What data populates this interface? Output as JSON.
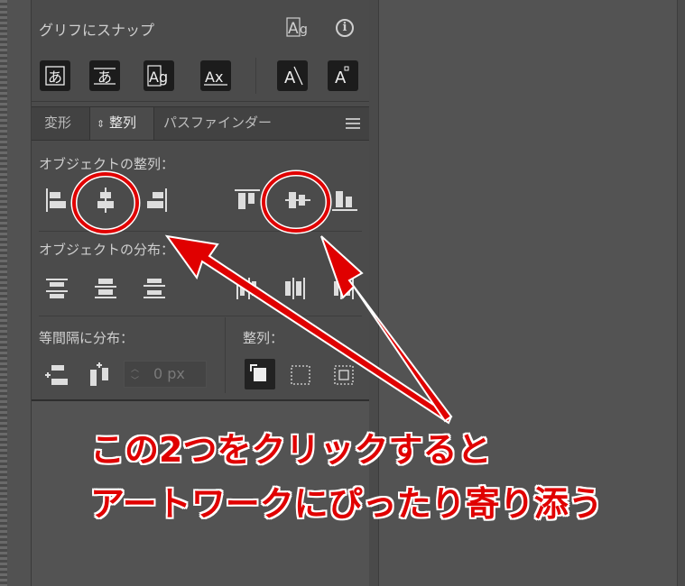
{
  "snap": {
    "title": "グリフにスナップ",
    "buttons": [
      {
        "label": "あ",
        "icon": "glyph-hiragana-icon"
      },
      {
        "label": "あ",
        "icon": "glyph-hiragana-bounds-icon"
      },
      {
        "label": "Ag",
        "icon": "glyph-ag-bounds-icon"
      },
      {
        "label": "Ax",
        "icon": "glyph-ax-baseline-icon"
      },
      {
        "label": "A",
        "icon": "glyph-angle-icon"
      },
      {
        "label": "A",
        "icon": "glyph-anchor-icon"
      }
    ]
  },
  "tabs": [
    {
      "label": "変形"
    },
    {
      "label": "整列"
    },
    {
      "label": "パスファインダー"
    }
  ],
  "align_objects": {
    "label": "オブジェクトの整列："
  },
  "distribute_objects": {
    "label": "オブジェクトの分布："
  },
  "distribute_spacing": {
    "label": "等間隔に分布："
  },
  "align_to": {
    "label": "整列："
  },
  "spacing_value": "0 px",
  "annotation": {
    "line1": "この2つをクリックすると",
    "line2": "アートワークにぴったり寄り添う",
    "color": "#e00000"
  }
}
